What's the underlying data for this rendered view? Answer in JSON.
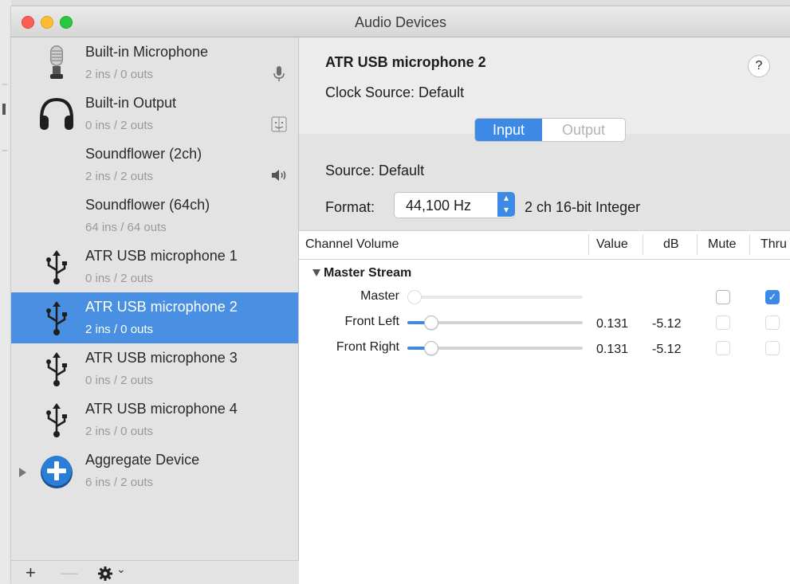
{
  "window": {
    "title": "Audio Devices"
  },
  "sidebar": {
    "devices": [
      {
        "name": "Built-in Microphone",
        "io": "2 ins / 0 outs",
        "icon": "microphone-icon",
        "right_icon": "mic-small-icon",
        "selected": false
      },
      {
        "name": "Built-in Output",
        "io": "0 ins / 2 outs",
        "icon": "headphones-icon",
        "right_icon": "finder-icon",
        "selected": false
      },
      {
        "name": "Soundflower (2ch)",
        "io": "2 ins / 2 outs",
        "icon": "",
        "right_icon": "speaker-icon",
        "selected": false
      },
      {
        "name": "Soundflower (64ch)",
        "io": "64 ins / 64 outs",
        "icon": "",
        "right_icon": "",
        "selected": false
      },
      {
        "name": "ATR USB microphone 1",
        "io": "0 ins / 2 outs",
        "icon": "usb-icon",
        "right_icon": "",
        "selected": false
      },
      {
        "name": "ATR USB microphone 2",
        "io": "2 ins / 0 outs",
        "icon": "usb-icon",
        "right_icon": "",
        "selected": true
      },
      {
        "name": "ATR USB microphone 3",
        "io": "0 ins / 2 outs",
        "icon": "usb-icon",
        "right_icon": "",
        "selected": false
      },
      {
        "name": "ATR USB microphone 4",
        "io": "2 ins / 0 outs",
        "icon": "usb-icon",
        "right_icon": "",
        "selected": false
      },
      {
        "name": "Aggregate Device",
        "io": "6 ins / 2 outs",
        "icon": "aggregate-plus-icon",
        "right_icon": "",
        "selected": false
      }
    ],
    "footer": {
      "add": "+",
      "remove": "—",
      "gear_chevron": "⌄"
    }
  },
  "detail": {
    "device_name": "ATR USB microphone 2",
    "clock_source": "Clock Source:  Default",
    "help": "?",
    "tabs": {
      "input": "Input",
      "output": "Output",
      "selected": "Input"
    },
    "source": "Source:  Default",
    "format_label": "Format:",
    "format_value": "44,100 Hz",
    "format_desc": "2 ch 16-bit Integer"
  },
  "table": {
    "headers": {
      "channel": "Channel Volume",
      "value": "Value",
      "db": "dB",
      "mute": "Mute",
      "thru": "Thru"
    },
    "group": "Master Stream",
    "rows": [
      {
        "label": "Master",
        "value": "",
        "db": "",
        "level": 0,
        "enabled": false,
        "mute": false,
        "thru": true
      },
      {
        "label": "Front Left",
        "value": "0.131",
        "db": "-5.12",
        "level": 0.131,
        "enabled": true,
        "mute": false,
        "thru": false
      },
      {
        "label": "Front Right",
        "value": "0.131",
        "db": "-5.12",
        "level": 0.131,
        "enabled": true,
        "mute": false,
        "thru": false
      }
    ]
  },
  "colors": {
    "accent": "#3d8ae6",
    "selection": "#4a90e2"
  }
}
